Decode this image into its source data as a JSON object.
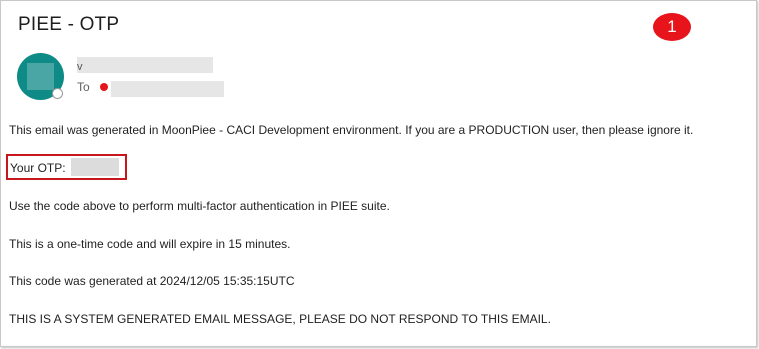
{
  "email": {
    "subject": "PIEE - OTP",
    "sender_mark": "v",
    "to_label": "To",
    "step_badge": "1",
    "body": {
      "environment_notice": "This email was generated in MoonPiee - CACI Development environment. If you are a PRODUCTION user, then please ignore it.",
      "otp_label": "Your OTP:",
      "instruction": "Use the code above to perform multi-factor authentication in PIEE suite.",
      "expiry_notice": "This is a one-time code and will expire in 15 minutes.",
      "generated_at": "This code was generated at 2024/12/05 15:35:15UTC",
      "system_notice": "THIS IS A SYSTEM GENERATED EMAIL MESSAGE, PLEASE DO NOT RESPOND TO THIS EMAIL."
    }
  },
  "colors": {
    "avatar": "#0e8a87",
    "badge": "#e8141c",
    "highlight_border": "#c8161d",
    "recipient_status": "#e3161d"
  },
  "icons": {
    "avatar": "sender-avatar",
    "presence": "presence-status-icon",
    "recipient": "recipient-status-dot"
  }
}
